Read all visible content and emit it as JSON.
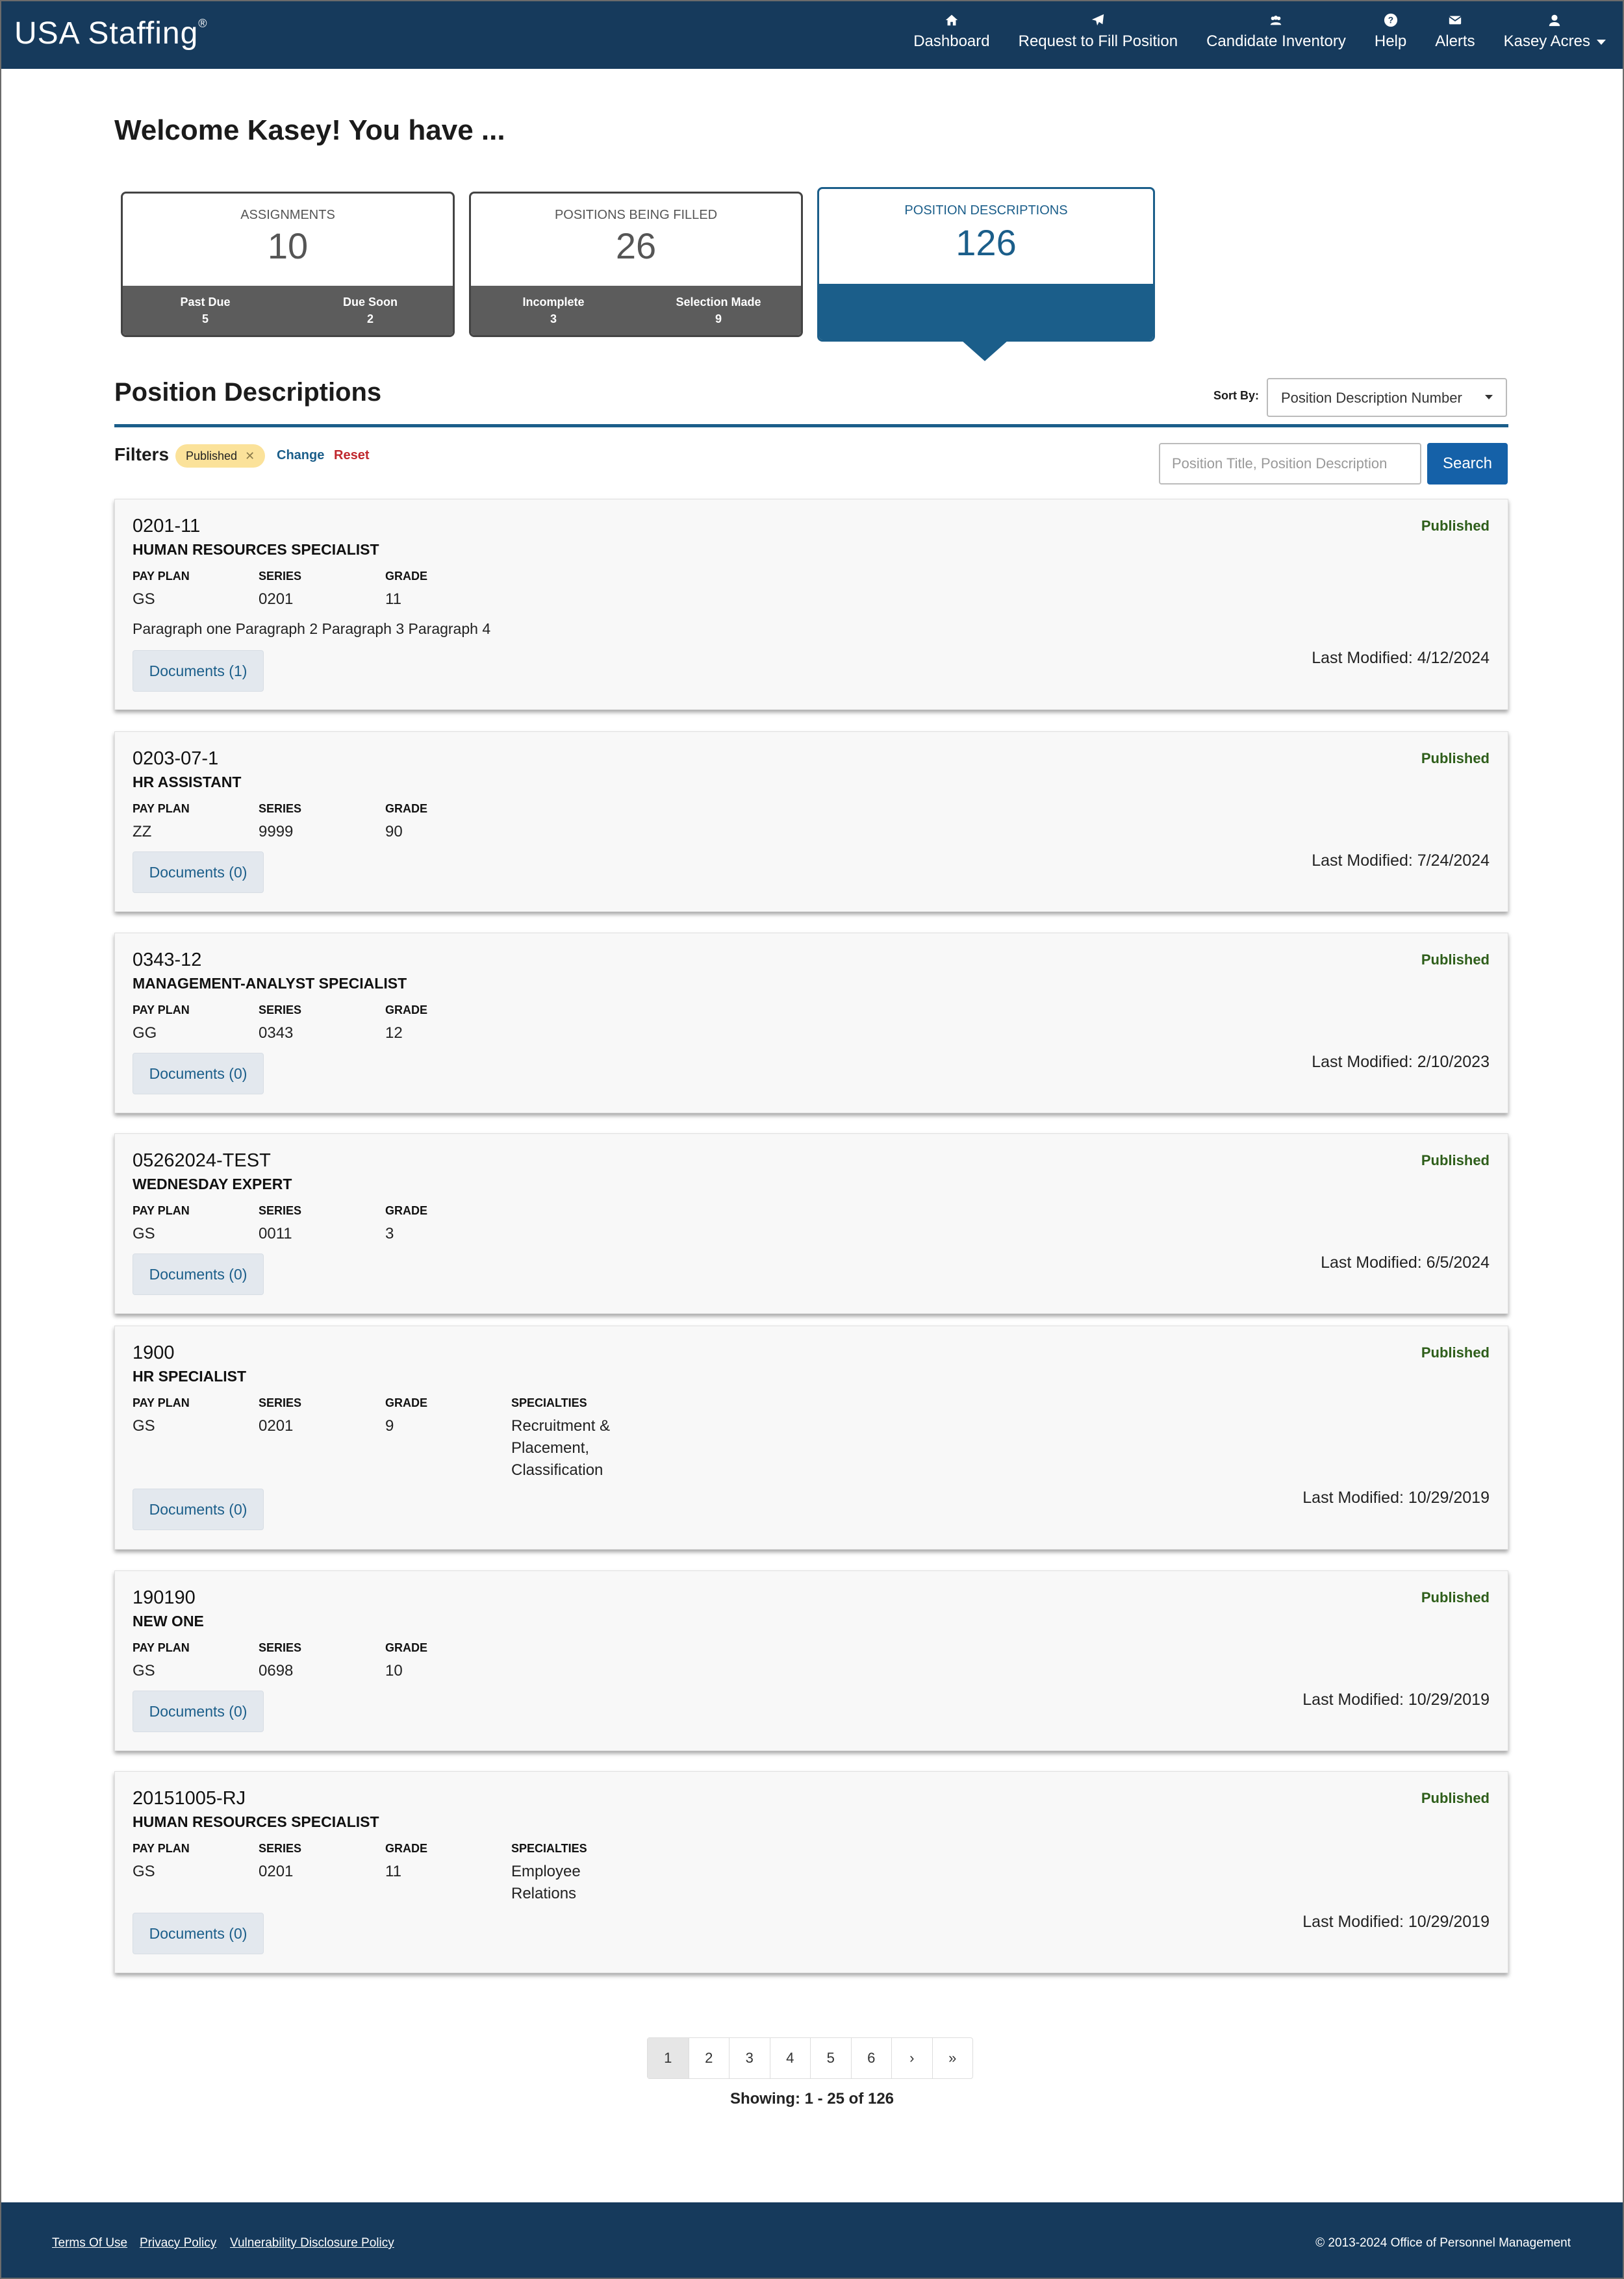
{
  "header": {
    "logo": "USA Staffing",
    "logo_mark": "®",
    "nav": [
      {
        "label": "Dashboard",
        "icon": "home-icon"
      },
      {
        "label": "Request to Fill Position",
        "icon": "paper-plane-icon"
      },
      {
        "label": "Candidate Inventory",
        "icon": "users-icon"
      },
      {
        "label": "Help",
        "icon": "question-circle-icon"
      },
      {
        "label": "Alerts",
        "icon": "envelope-icon"
      },
      {
        "label": "Kasey Acres",
        "icon": "user-icon"
      }
    ]
  },
  "welcome": "Welcome Kasey! You have ...",
  "summary": {
    "assignments": {
      "title": "ASSIGNMENTS",
      "count": "10",
      "left_label": "Past Due",
      "left_value": "5",
      "right_label": "Due Soon",
      "right_value": "2"
    },
    "positions": {
      "title": "POSITIONS BEING FILLED",
      "count": "26",
      "left_label": "Incomplete",
      "left_value": "3",
      "right_label": "Selection Made",
      "right_value": "9"
    },
    "descriptions": {
      "title": "POSITION DESCRIPTIONS",
      "count": "126"
    }
  },
  "section": {
    "title": "Position Descriptions",
    "sort_label": "Sort By:",
    "sort_value": "Position Description Number"
  },
  "filters": {
    "label": "Filters",
    "chip": "Published",
    "change": "Change",
    "reset": "Reset",
    "search_placeholder": "Position Title, Position Description",
    "search_button": "Search"
  },
  "labels": {
    "pay_plan": "PAY PLAN",
    "series": "SERIES",
    "grade": "GRADE",
    "specialties": "SPECIALTIES"
  },
  "results": [
    {
      "number": "0201-11",
      "title": "HUMAN RESOURCES SPECIALIST",
      "status": "Published",
      "pay_plan": "GS",
      "series": "0201",
      "grade": "11",
      "description": "Paragraph one Paragraph 2 Paragraph 3 Paragraph 4",
      "documents": "Documents (1)",
      "last_modified": "Last Modified: 4/12/2024"
    },
    {
      "number": "0203-07-1",
      "title": "HR ASSISTANT",
      "status": "Published",
      "pay_plan": "ZZ",
      "series": "9999",
      "grade": "90",
      "documents": "Documents (0)",
      "last_modified": "Last Modified: 7/24/2024"
    },
    {
      "number": "0343-12",
      "title": "MANAGEMENT-ANALYST SPECIALIST",
      "status": "Published",
      "pay_plan": "GG",
      "series": "0343",
      "grade": "12",
      "documents": "Documents (0)",
      "last_modified": "Last Modified: 2/10/2023"
    },
    {
      "number": "05262024-TEST",
      "title": "WEDNESDAY EXPERT",
      "status": "Published",
      "pay_plan": "GS",
      "series": "0011",
      "grade": "3",
      "documents": "Documents (0)",
      "last_modified": "Last Modified: 6/5/2024"
    },
    {
      "number": "1900",
      "title": "HR SPECIALIST",
      "status": "Published",
      "pay_plan": "GS",
      "series": "0201",
      "grade": "9",
      "specialties": [
        "Recruitment &",
        "Placement,",
        "Classification"
      ],
      "documents": "Documents (0)",
      "last_modified": "Last Modified: 10/29/2019"
    },
    {
      "number": "190190",
      "title": "NEW ONE",
      "status": "Published",
      "pay_plan": "GS",
      "series": "0698",
      "grade": "10",
      "documents": "Documents (0)",
      "last_modified": "Last Modified: 10/29/2019"
    },
    {
      "number": "20151005-RJ",
      "title": "HUMAN RESOURCES SPECIALIST",
      "status": "Published",
      "pay_plan": "GS",
      "series": "0201",
      "grade": "11",
      "specialties": [
        "Employee",
        "Relations"
      ],
      "documents": "Documents (0)",
      "last_modified": "Last Modified: 10/29/2019"
    }
  ],
  "pagination": {
    "pages": [
      "1",
      "2",
      "3",
      "4",
      "5",
      "6",
      "›",
      "»"
    ],
    "showing": "Showing: 1 - 25 of 126"
  },
  "footer": {
    "terms": "Terms Of Use",
    "privacy": "Privacy Policy",
    "vdp": "Vulnerability Disclosure Policy",
    "copyright": "© 2013-2024 Office of Personnel Management"
  }
}
